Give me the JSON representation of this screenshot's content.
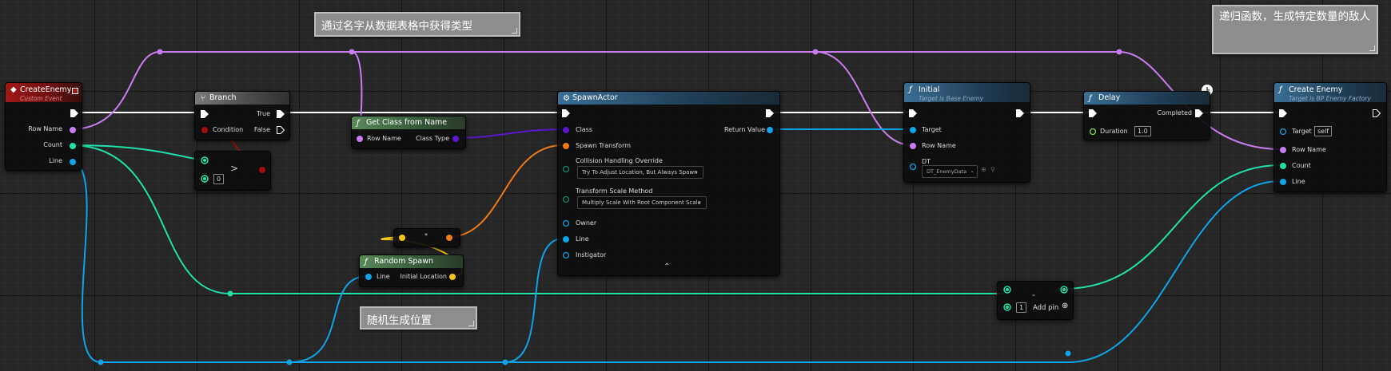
{
  "comments": {
    "top_left": "通过名字从数据表格中获得类型",
    "top_right": "递归函数，生成特定数量的敌人",
    "bottom": "随机生成位置"
  },
  "nodes": {
    "create_enemy_event": {
      "title": "CreateEnemy",
      "subtitle": "Custom Event",
      "pins": [
        "Row Name",
        "Count",
        "Line"
      ]
    },
    "branch": {
      "title": "Branch",
      "pins": {
        "condition": "Condition",
        "true": "True",
        "false": "False"
      }
    },
    "greater": {
      "symbol": ">",
      "b_value": "0"
    },
    "get_class_from_name": {
      "title": "Get Class from Name",
      "pins": {
        "row_name": "Row Name",
        "class_type": "Class Type"
      }
    },
    "spawn_actor": {
      "title": "SpawnActor",
      "pins": {
        "class": "Class",
        "spawn_transform": "Spawn Transform",
        "collision_label": "Collision Handling Override",
        "collision_value": "Try To Adjust Location, But Always Spawn",
        "scale_label": "Transform Scale Method",
        "scale_value": "Multiply Scale With Root Component Scale",
        "owner": "Owner",
        "line": "Line",
        "instigator": "Instigator",
        "return_value": "Return Value"
      },
      "expand_icon": "chevron-up-icon"
    },
    "multiply": {
      "symbol": "*"
    },
    "random_spawn": {
      "title": "Random Spawn",
      "pins": {
        "line": "Line",
        "initial_location": "Initial Location"
      }
    },
    "initial": {
      "title": "Initial",
      "subtitle": "Target is Base Enemy",
      "pins": {
        "target": "Target",
        "row_name": "Row Name",
        "dt": "DT",
        "dt_value": "DT_EnemyData"
      }
    },
    "delay": {
      "title": "Delay",
      "pins": {
        "duration": "Duration",
        "duration_value": "1.0",
        "completed": "Completed"
      }
    },
    "create_enemy_call": {
      "title": "Create Enemy",
      "subtitle": "Target is BP Enemy Factory",
      "pins": {
        "target": "Target",
        "target_value": "self",
        "row_name": "Row Name",
        "count": "Count",
        "line": "Line"
      }
    },
    "subtract": {
      "symbol": "-",
      "b_value": "1",
      "add_pin": "Add pin"
    }
  },
  "colors": {
    "exec": "#ffffff",
    "name": "#c77df0",
    "int": "#1fe0a8",
    "object": "#0fa3e8",
    "class": "#5b17c9",
    "transform": "#ee7a18",
    "vector": "#f5c518",
    "bool": "#a10d0d"
  }
}
